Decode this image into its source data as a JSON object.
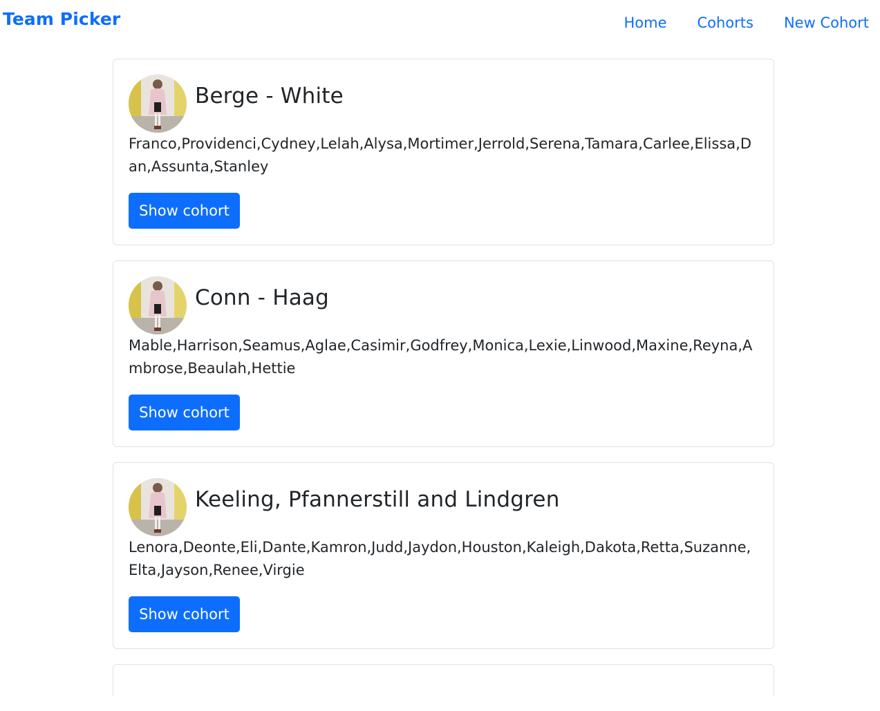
{
  "navbar": {
    "brand": "Team Picker",
    "links": [
      {
        "label": "Home"
      },
      {
        "label": "Cohorts"
      },
      {
        "label": "New Cohort"
      }
    ]
  },
  "cohorts": [
    {
      "title": "Berge - White",
      "members": "Franco,Providenci,Cydney,Lelah,Alysa,Mortimer,Jerrold,Serena,Tamara,Carlee,Elissa,Dan,Assunta,Stanley",
      "button_label": "Show cohort",
      "avatar_icon": "person-photo-icon"
    },
    {
      "title": "Conn - Haag",
      "members": "Mable,Harrison,Seamus,Aglae,Casimir,Godfrey,Monica,Lexie,Linwood,Maxine,Reyna,Ambrose,Beaulah,Hettie",
      "button_label": "Show cohort",
      "avatar_icon": "person-photo-icon"
    },
    {
      "title": "Keeling, Pfannerstill and Lindgren",
      "members": "Lenora,Deonte,Eli,Dante,Kamron,Judd,Jaydon,Houston,Kaleigh,Dakota,Retta,Suzanne,Elta,Jayson,Renee,Virgie",
      "button_label": "Show cohort",
      "avatar_icon": "person-photo-icon"
    }
  ],
  "colors": {
    "primary": "#0d6efd",
    "border": "#dee2e6",
    "text": "#212529"
  }
}
